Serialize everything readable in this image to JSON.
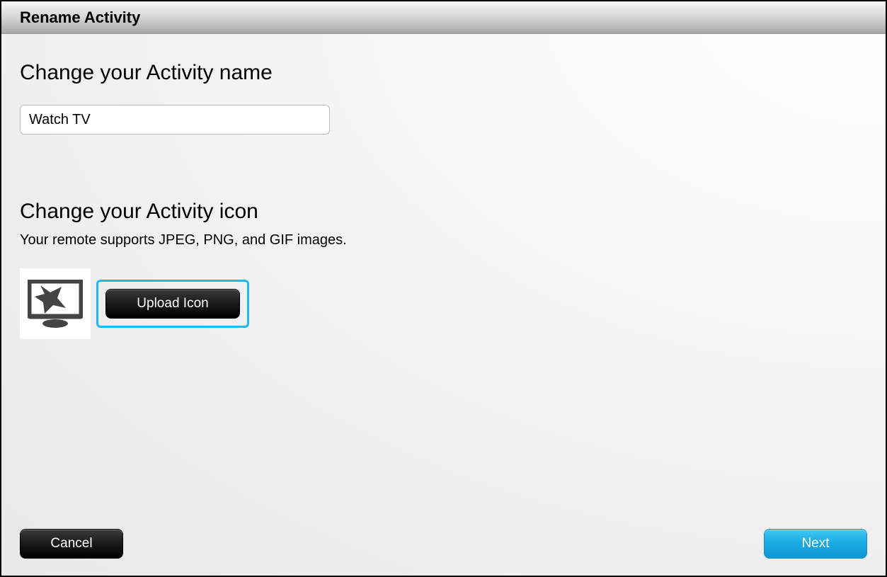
{
  "dialog": {
    "title": "Rename Activity"
  },
  "nameSection": {
    "heading": "Change your Activity name",
    "value": "Watch TV"
  },
  "iconSection": {
    "heading": "Change your Activity icon",
    "supportsText": "Your remote supports JPEG, PNG, and GIF images.",
    "uploadLabel": "Upload Icon"
  },
  "footer": {
    "cancelLabel": "Cancel",
    "nextLabel": "Next"
  }
}
